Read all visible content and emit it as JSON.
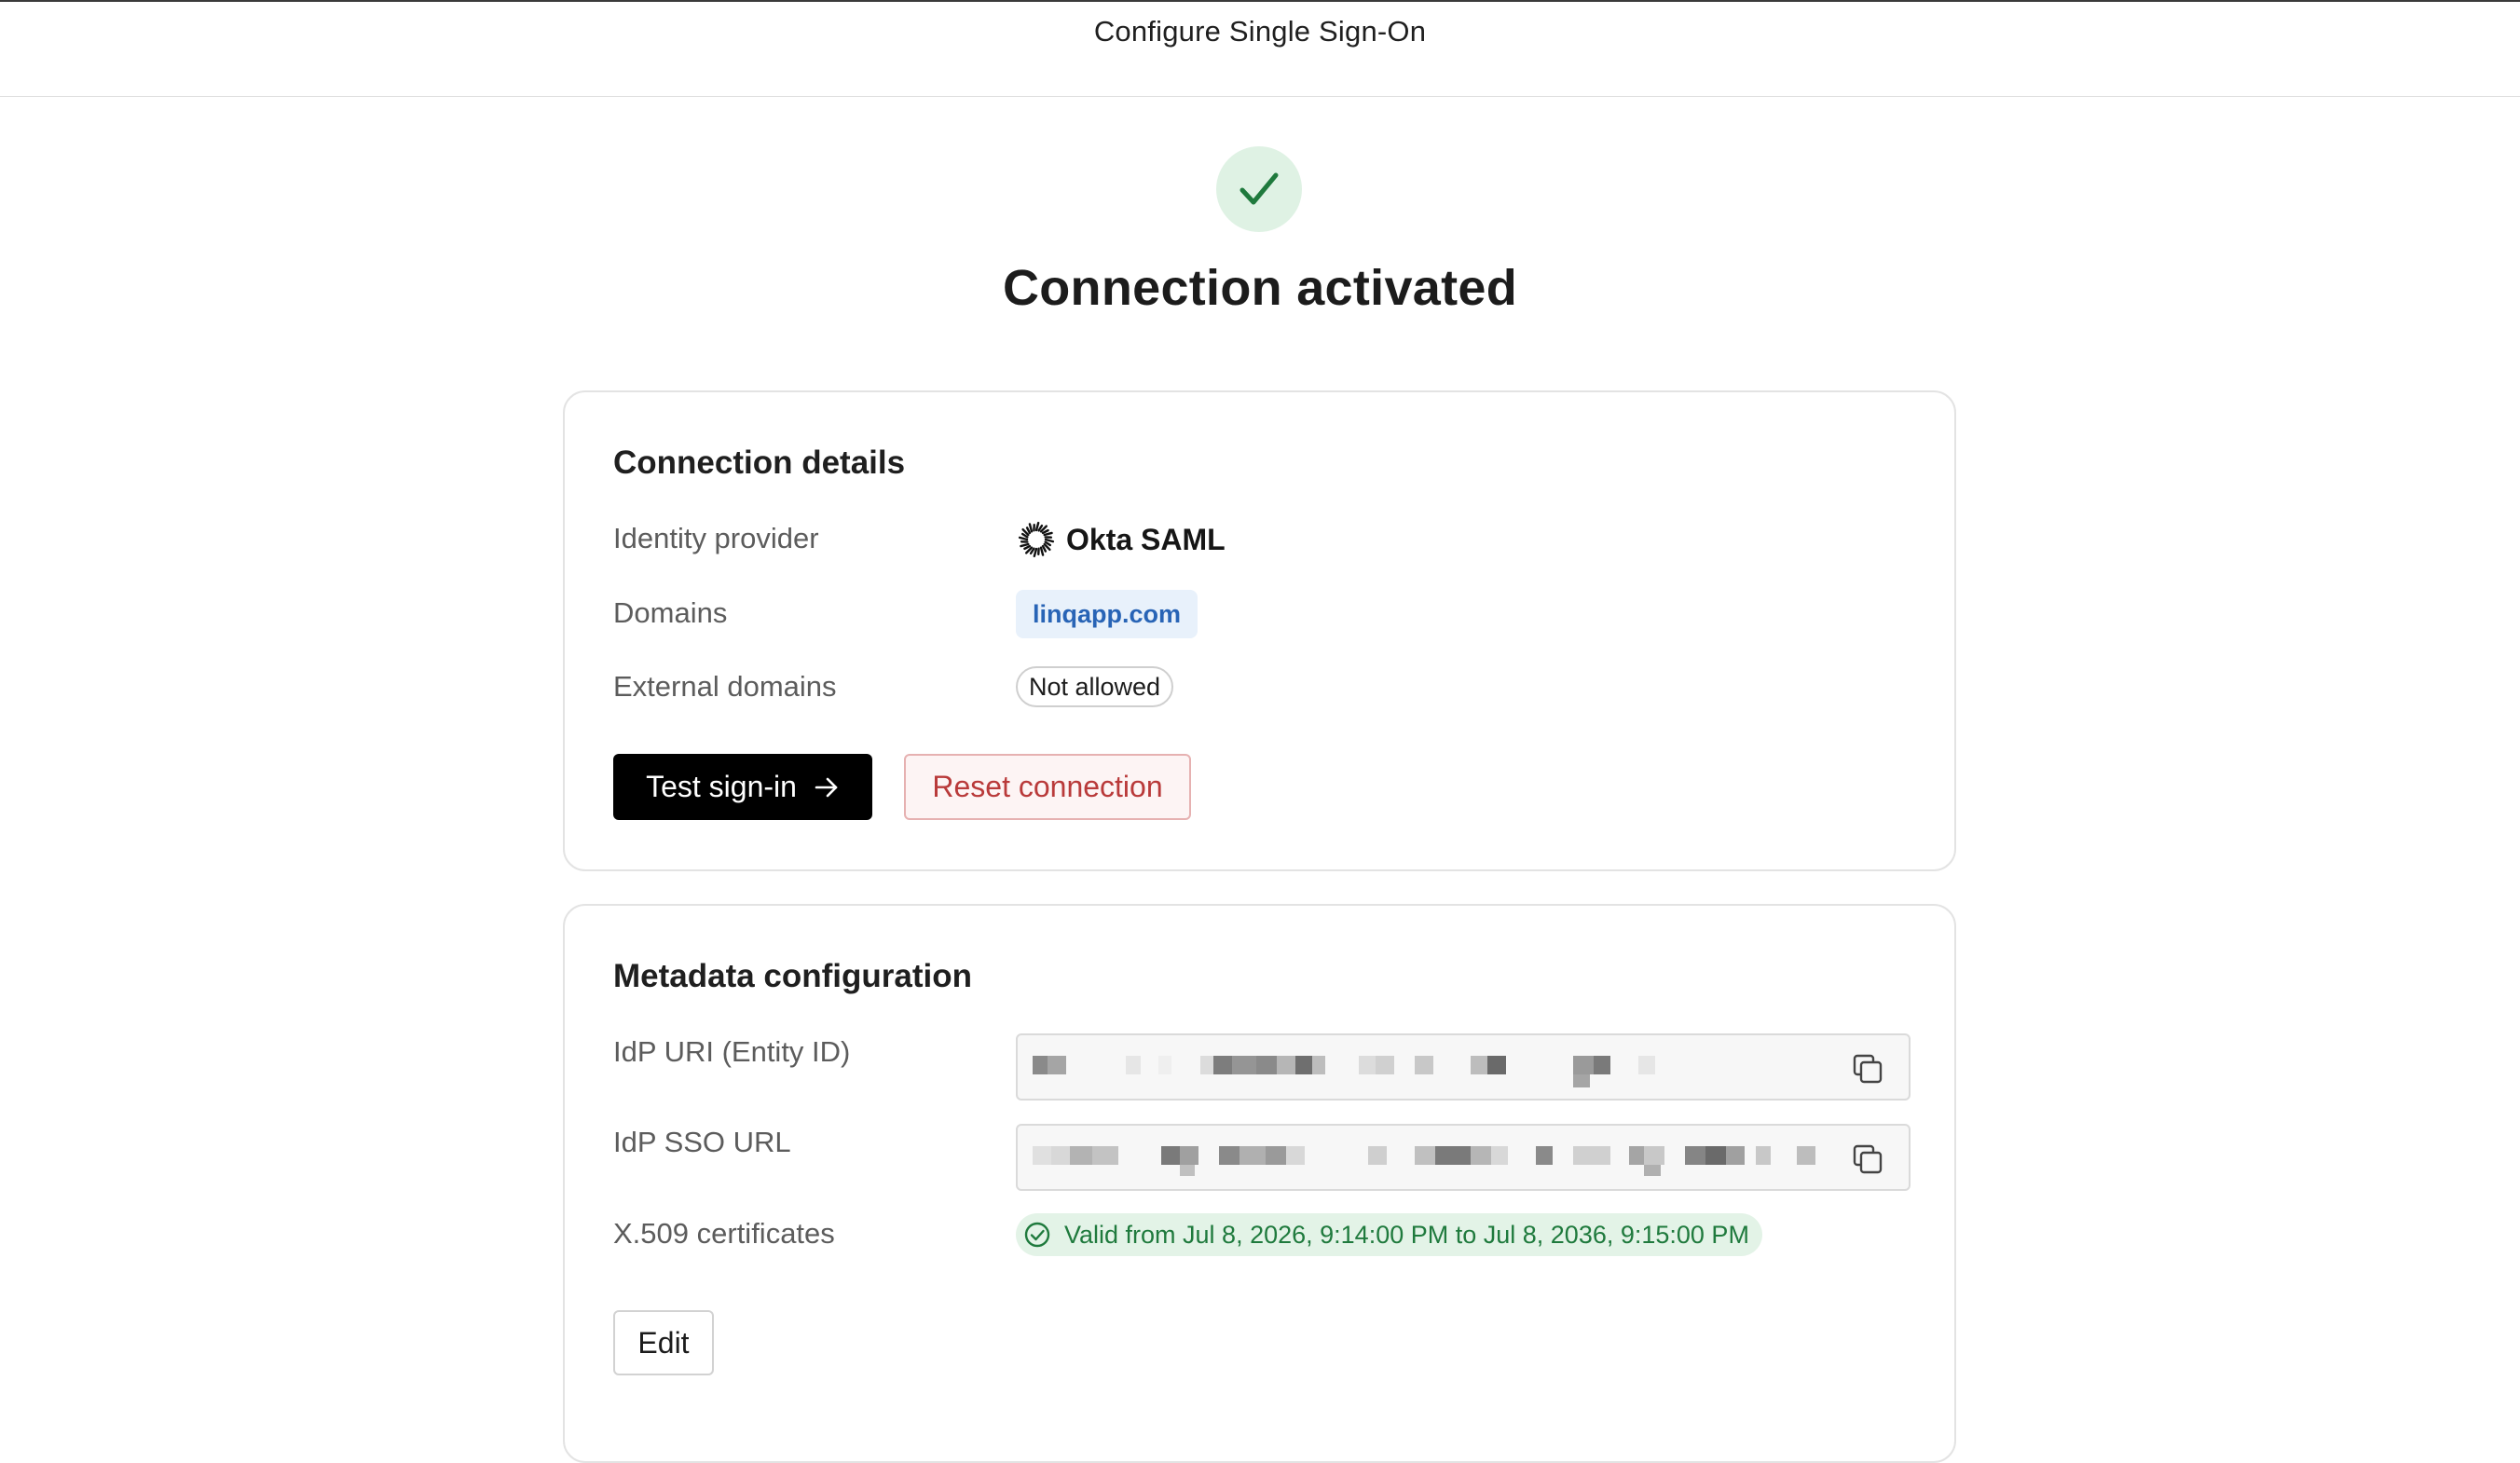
{
  "page": {
    "title": "Configure Single Sign-On"
  },
  "status": {
    "heading": "Connection activated",
    "icon": "check-icon"
  },
  "connection_details": {
    "title": "Connection details",
    "identity_provider_label": "Identity provider",
    "identity_provider_value": "Okta SAML",
    "identity_provider_icon": "okta-logo-icon",
    "domains_label": "Domains",
    "domains": [
      "linqapp.com"
    ],
    "external_domains_label": "External domains",
    "external_domains_value": "Not allowed",
    "test_signin_label": "Test sign-in",
    "test_signin_icon": "arrow-right-icon",
    "reset_label": "Reset connection"
  },
  "metadata_configuration": {
    "title": "Metadata configuration",
    "idp_uri_label": "IdP URI (Entity ID)",
    "idp_sso_url_label": "IdP SSO URL",
    "x509_label": "X.509 certificates",
    "certificate_status": "Valid from Jul 8, 2026, 9:14:00 PM to Jul 8, 2036, 9:15:00 PM",
    "certificate_icon": "check-circle-icon",
    "copy_icon": "copy-icon",
    "edit_label": "Edit"
  },
  "colors": {
    "success_bg": "#dff2e4",
    "success_fg": "#1f7a3d",
    "domain_chip_bg": "#e8f1fb",
    "domain_chip_fg": "#2864b6",
    "danger_fg": "#b93a3a",
    "primary_button_bg": "#000000"
  }
}
